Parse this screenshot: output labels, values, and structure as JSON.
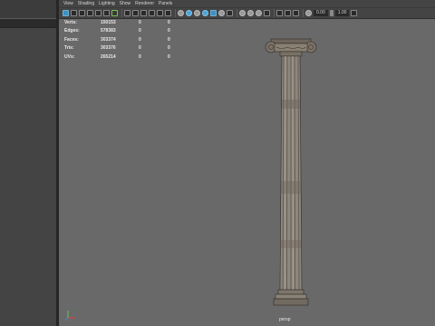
{
  "menu": [
    "View",
    "Shading",
    "Lighting",
    "Show",
    "Renderer",
    "Panels"
  ],
  "toolbar": {
    "field_left": "0.00",
    "field_right": "1.00"
  },
  "stats": [
    {
      "label": "Verts:",
      "v1": "150153",
      "v2": "0",
      "v3": "0"
    },
    {
      "label": "Edges:",
      "v1": "578383",
      "v2": "0",
      "v3": "0"
    },
    {
      "label": "Faces:",
      "v1": "303374",
      "v2": "0",
      "v3": "0"
    },
    {
      "label": "Tris:",
      "v1": "303376",
      "v2": "0",
      "v3": "0"
    },
    {
      "label": "UVs:",
      "v1": "265214",
      "v2": "0",
      "v3": "0"
    }
  ],
  "camera_label": "persp"
}
